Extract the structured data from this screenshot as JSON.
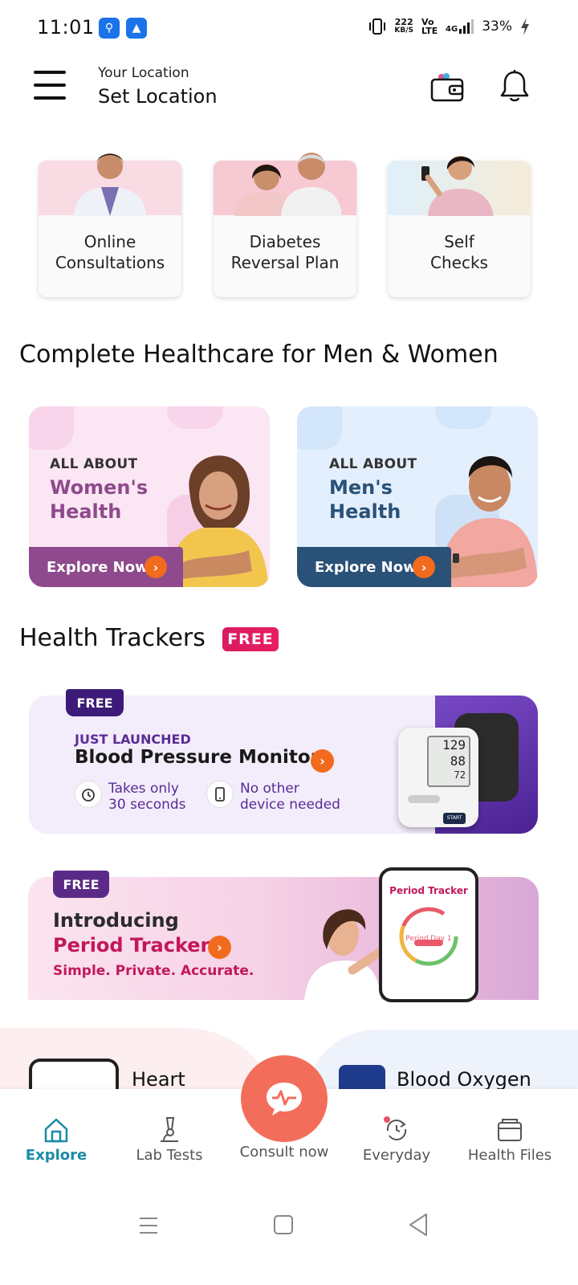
{
  "status_bar": {
    "time": "11:01",
    "speed_value": "222",
    "speed_unit": "KB/S",
    "volte": "Vo LTE",
    "network": "4G",
    "battery": "33%"
  },
  "header": {
    "location_label": "Your Location",
    "location_value": "Set Location"
  },
  "services": [
    {
      "label_line1": "Online",
      "label_line2": "Consultations"
    },
    {
      "label_line1": "Diabetes",
      "label_line2": "Reversal Plan"
    },
    {
      "label_line1": "Self",
      "label_line2": "Checks"
    }
  ],
  "healthcare_section": {
    "title": "Complete Healthcare for Men & Women",
    "cards": [
      {
        "small": "ALL ABOUT",
        "big_line1": "Women's",
        "big_line2": "Health",
        "button": "Explore Now"
      },
      {
        "small": "ALL ABOUT",
        "big_line1": "Men's",
        "big_line2": "Health",
        "button": "Explore Now"
      }
    ]
  },
  "trackers_section": {
    "title": "Health Trackers",
    "badge": "FREE"
  },
  "bp_card": {
    "badge": "FREE",
    "kicker": "JUST LAUNCHED",
    "title": "Blood Pressure Monitor",
    "feature1_line1": "Takes only",
    "feature1_line2": "30 seconds",
    "feature2_line1": "No other",
    "feature2_line2": "device needed",
    "device_sys": "129",
    "device_dia": "88",
    "device_pulse": "72",
    "device_start": "START"
  },
  "period_card": {
    "badge": "FREE",
    "line1": "Introducing",
    "line2": "Period Tracker",
    "line3": "Simple. Private. Accurate.",
    "phone_title": "Period Tracker",
    "phone_day": "Period Day 1"
  },
  "peek_cards": {
    "left_label": "Heart",
    "right_label": "Blood Oxygen"
  },
  "bottom_nav": {
    "explore": "Explore",
    "lab_tests": "Lab Tests",
    "consult": "Consult now",
    "everyday": "Everyday",
    "health_files": "Health Files"
  },
  "colors": {
    "accent": "#1a8ba8",
    "orange": "#f26b1d",
    "consult": "#f36e5a",
    "women": "#8e4a8c",
    "men": "#2a5178"
  }
}
